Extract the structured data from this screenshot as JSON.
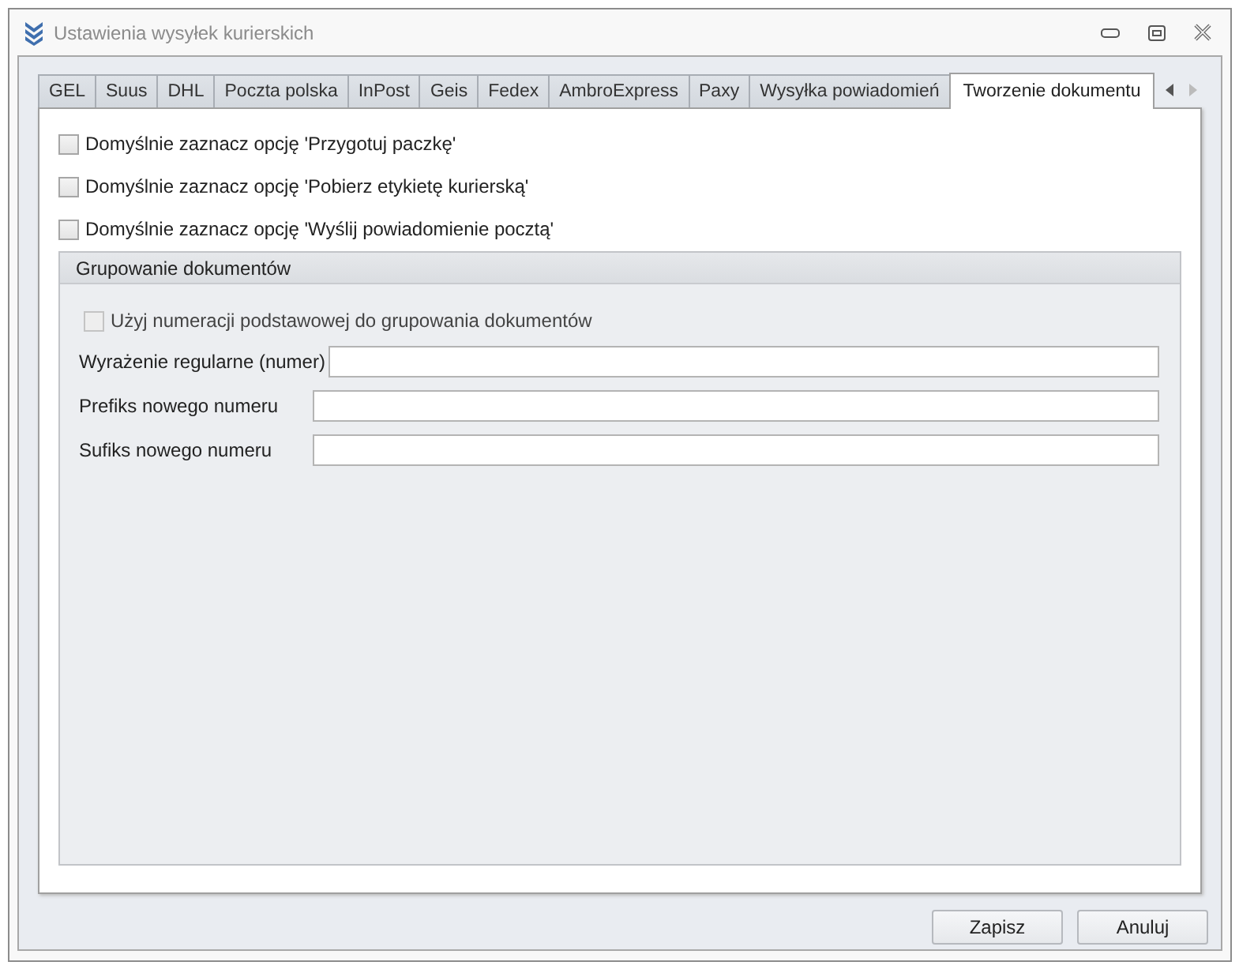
{
  "window": {
    "title": "Ustawienia wysyłek kurierskich"
  },
  "tabs": [
    {
      "label": "GEL",
      "selected": false
    },
    {
      "label": "Suus",
      "selected": false
    },
    {
      "label": "DHL",
      "selected": false
    },
    {
      "label": "Poczta polska",
      "selected": false
    },
    {
      "label": "InPost",
      "selected": false
    },
    {
      "label": "Geis",
      "selected": false
    },
    {
      "label": "Fedex",
      "selected": false
    },
    {
      "label": "AmbroExpress",
      "selected": false
    },
    {
      "label": "Paxy",
      "selected": false
    },
    {
      "label": "Wysyłka powiadomień",
      "selected": false
    },
    {
      "label": "Tworzenie dokumentu",
      "selected": true
    }
  ],
  "options": [
    {
      "label": "Domyślnie zaznacz opcję 'Przygotuj paczkę'",
      "checked": false
    },
    {
      "label": "Domyślnie zaznacz opcję 'Pobierz etykietę kurierską'",
      "checked": false
    },
    {
      "label": "Domyślnie zaznacz opcję 'Wyślij powiadomienie pocztą'",
      "checked": false
    }
  ],
  "group": {
    "title": "Grupowanie dokumentów",
    "option": {
      "label": "Użyj numeracji podstawowej do grupowania dokumentów",
      "checked": false,
      "disabled": true
    },
    "fields": [
      {
        "label": "Wyrażenie regularne (numer)"
      },
      {
        "label": "Prefiks nowego numeru"
      },
      {
        "label": "Sufiks nowego numeru"
      }
    ]
  },
  "buttons": [
    "Zapisz",
    "Anuluj"
  ]
}
